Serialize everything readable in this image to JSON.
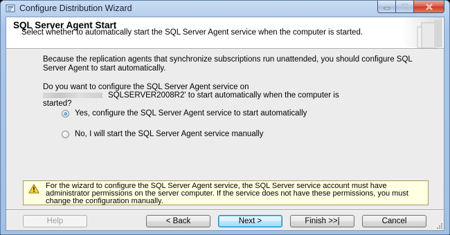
{
  "window": {
    "title": "Configure Distribution Wizard"
  },
  "header": {
    "title": "SQL Server Agent Start",
    "subtitle": "Select whether to automatically start the SQL Server Agent service when the computer is started."
  },
  "body": {
    "intro": "Because the replication agents that synchronize subscriptions run unattended, you should configure SQL Server Agent to start automatically.",
    "question_line1": "Do you want to configure the SQL Server Agent service on",
    "question_server": "SQLSERVER2008R2",
    "question_rest": "' to start automatically when the computer is",
    "question_line3": "started?",
    "options": [
      {
        "label": "Yes, configure the SQL Server Agent service to start automatically",
        "checked": true
      },
      {
        "label": "No, I will start the SQL Server Agent service manually",
        "checked": false
      }
    ]
  },
  "warning": {
    "icon": "warning-icon",
    "text": "For the wizard to configure the SQL Server Agent service, the SQL Server service account must have administrator permissions on the server computer. If the service does not have these permissions, you must change the configuration manually."
  },
  "buttons": {
    "help": "Help",
    "back": "< Back",
    "next": "Next >",
    "finish": "Finish >>|",
    "cancel": "Cancel"
  },
  "colors": {
    "title_bar": "#b7cfec",
    "close_button": "#c53b2a",
    "warning_background": "#ffffe1",
    "client_background": "#ececec"
  }
}
